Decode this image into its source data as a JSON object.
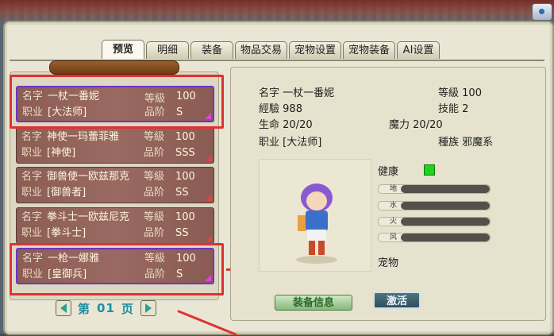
{
  "tabs": [
    "预览",
    "明细",
    "装备",
    "物品交易",
    "宠物设置",
    "宠物装备",
    "AI设置"
  ],
  "labels": {
    "name": "名字",
    "level": "等級",
    "job": "职业",
    "rank": "品阶",
    "exp": "經驗",
    "skill": "技能",
    "hp": "生命",
    "mp": "魔力",
    "race": "種族",
    "health": "健康",
    "pet": "宠物"
  },
  "characters": [
    {
      "name": "一杖一番妮",
      "level": "100",
      "job": "[大法师]",
      "rank": "S"
    },
    {
      "name": "神使一玛蕾菲雅",
      "level": "100",
      "job": "[神使]",
      "rank": "SSS"
    },
    {
      "name": "御兽使一欧兹那克",
      "level": "100",
      "job": "[御兽者]",
      "rank": "SS"
    },
    {
      "name": "拳斗士一欧兹尼克",
      "level": "100",
      "job": "[拳斗士]",
      "rank": "SS"
    },
    {
      "name": "一枪一娜雅",
      "level": "100",
      "job": "[皇御兵]",
      "rank": "S"
    }
  ],
  "pager": {
    "prefix": "第",
    "page": "01",
    "suffix": "页"
  },
  "detail": {
    "name": "一杖一番妮",
    "level": "100",
    "exp": "988",
    "skill": "2",
    "hp": "20/20",
    "mp": "20/20",
    "job": "[大法师]",
    "race": "邪魔系"
  },
  "elements": [
    {
      "label": "地",
      "level": 0.8
    },
    {
      "label": "水",
      "level": 0.8
    },
    {
      "label": "火",
      "level": 0.8
    },
    {
      "label": "风",
      "level": 0.8
    }
  ],
  "buttons": {
    "equip_info": "装备信息",
    "activate": "激活"
  },
  "colors": {
    "highlight": "#e0312f",
    "selected_border": "#6a36c8",
    "health_ok": "#22d022"
  }
}
